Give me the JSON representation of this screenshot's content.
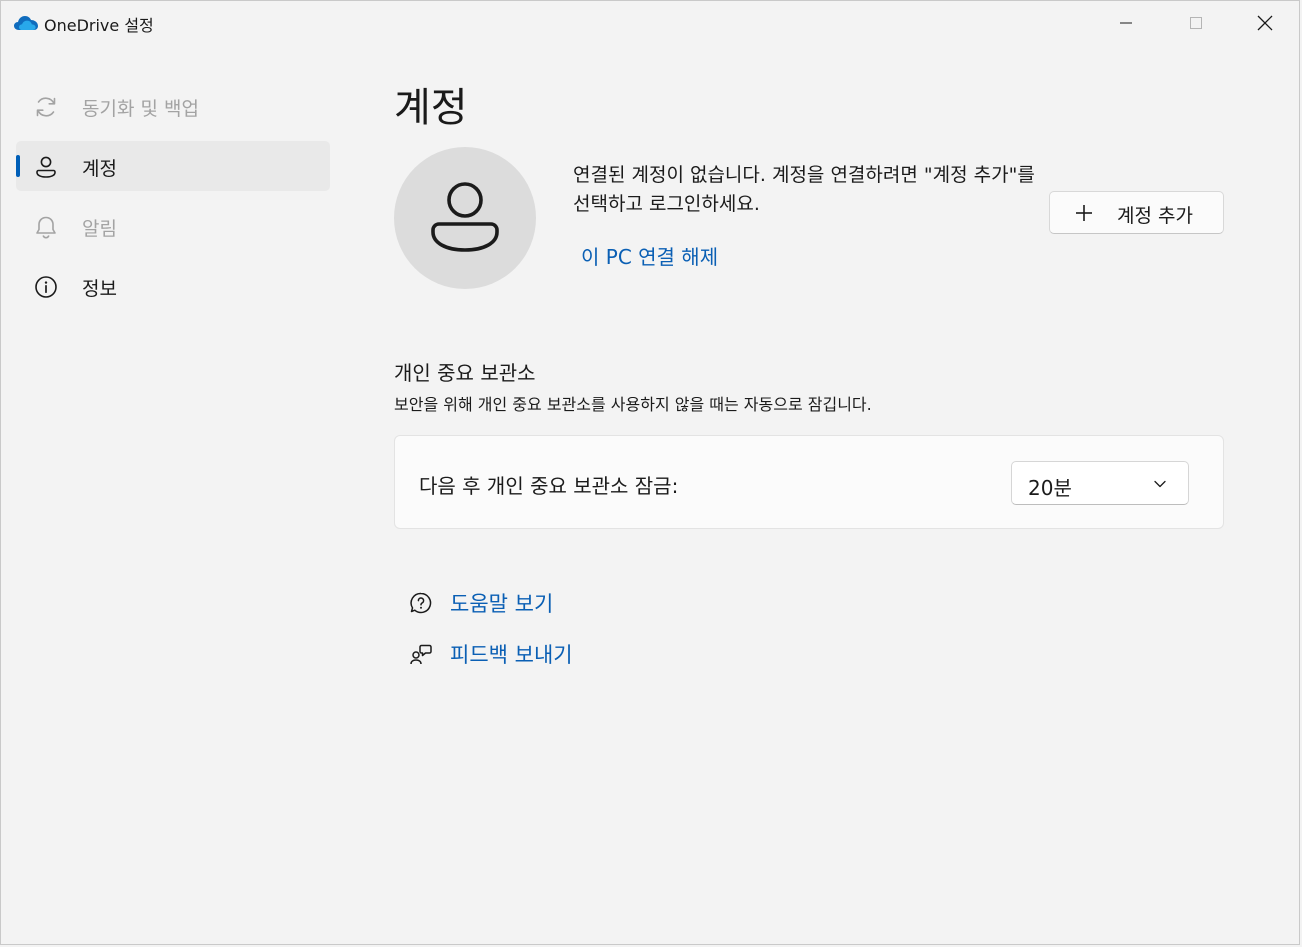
{
  "window": {
    "title": "OneDrive 설정",
    "controls": [
      "minimize",
      "maximize",
      "close"
    ]
  },
  "sidebar": {
    "items": [
      {
        "label": "동기화 및 백업",
        "icon": "sync-icon",
        "state": "disabled"
      },
      {
        "label": "계정",
        "icon": "person-icon",
        "state": "selected"
      },
      {
        "label": "알림",
        "icon": "bell-icon",
        "state": "disabled"
      },
      {
        "label": "정보",
        "icon": "info-icon",
        "state": "normal"
      }
    ]
  },
  "main": {
    "title": "계정",
    "account": {
      "message": "연결된 계정이 없습니다. 계정을 연결하려면 \"계정 추가\"를 선택하고 로그인하세요.",
      "unlink_link": "이 PC 연결 해제",
      "add_button": "계정 추가"
    },
    "vault": {
      "title": "개인 중요 보관소",
      "description": "보안을 위해 개인 중요 보관소를 사용하지 않을 때는 자동으로 잠깁니다.",
      "lock_label": "다음 후 개인 중요 보관소 잠금:",
      "lock_value": "20분"
    },
    "help_links": [
      {
        "label": "도움말 보기",
        "icon": "help-question-icon"
      },
      {
        "label": "피드백 보내기",
        "icon": "feedback-icon"
      }
    ]
  },
  "colors": {
    "accent": "#005fb8",
    "link": "#0a5fb4",
    "background": "#f3f3f3",
    "card": "#fbfbfb"
  }
}
